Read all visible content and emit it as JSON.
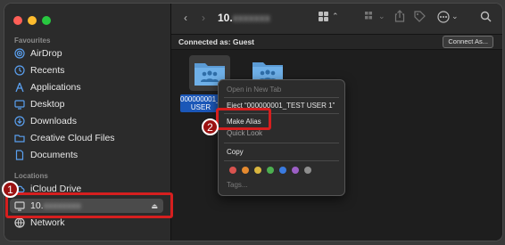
{
  "sidebar": {
    "favourites_label": "Favourites",
    "locations_label": "Locations",
    "items": [
      {
        "label": "AirDrop",
        "icon": "airdrop-icon"
      },
      {
        "label": "Recents",
        "icon": "clock-icon"
      },
      {
        "label": "Applications",
        "icon": "applications-icon"
      },
      {
        "label": "Desktop",
        "icon": "desktop-icon"
      },
      {
        "label": "Downloads",
        "icon": "downloads-icon"
      },
      {
        "label": "Creative Cloud Files",
        "icon": "folder-icon"
      },
      {
        "label": "Documents",
        "icon": "document-icon"
      }
    ],
    "locations": [
      {
        "label": "iCloud Drive",
        "icon": "cloud-icon"
      },
      {
        "label": "10.",
        "icon": "monitor-icon",
        "selected": true
      },
      {
        "label": "Network",
        "icon": "network-icon"
      }
    ]
  },
  "toolbar": {
    "title": "10.",
    "back_label": "‹",
    "forward_label": "›"
  },
  "connection": {
    "status": "Connected as: Guest",
    "button": "Connect As..."
  },
  "files": [
    {
      "label": "000000001_\nUSER",
      "selected": true
    },
    {
      "label": ""
    }
  ],
  "context_menu": {
    "items": [
      {
        "label": "Open in New Tab",
        "enabled": false
      },
      {
        "label": "Eject “000000001_TEST USER 1”",
        "enabled": true
      },
      {
        "label": "Make Alias",
        "enabled": true
      },
      {
        "label": "Quick Look",
        "enabled": true
      },
      {
        "label": "Copy",
        "enabled": true
      },
      {
        "label": "Tags...",
        "enabled": false
      }
    ],
    "tag_colors": [
      "#d9534f",
      "#e58a2f",
      "#d9b63f",
      "#4caf50",
      "#3a7be0",
      "#9c5fc5",
      "#8e8e8e"
    ]
  },
  "annotations": [
    {
      "number": "1"
    },
    {
      "number": "2"
    }
  ],
  "colors": {
    "accent_selection": "#1b57b8",
    "annotation_red": "#d61f1f",
    "traffic_red": "#ff5f57",
    "traffic_yellow": "#febc2e",
    "traffic_green": "#28c840"
  }
}
